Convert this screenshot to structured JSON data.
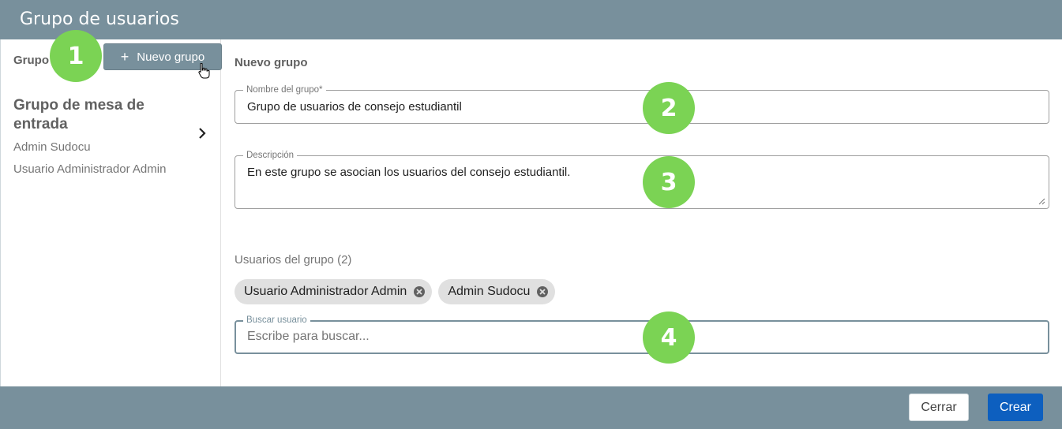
{
  "dialog": {
    "title": "Grupo de usuarios"
  },
  "sidebar": {
    "groups_label": "Grupo",
    "new_group_button": "Nuevo grupo",
    "groups": [
      {
        "name": "Grupo de mesa de entrada",
        "members": [
          "Admin Sudocu",
          "Usuario Administrador Admin"
        ]
      }
    ]
  },
  "form": {
    "section_title": "Nuevo grupo",
    "name_label": "Nombre del grupo*",
    "name_value": "Grupo de usuarios de consejo estudiantil",
    "description_label": "Descripción",
    "description_value": "En este grupo se asocian los usuarios del consejo estudiantil.",
    "users_title": "Usuarios del grupo (2)",
    "selected_users": [
      "Usuario Administrador Admin",
      "Admin Sudocu"
    ],
    "search_label": "Buscar usuario",
    "search_placeholder": "Escribe para buscar..."
  },
  "footer": {
    "close_button": "Cerrar",
    "create_button": "Crear"
  },
  "annotations": [
    "1",
    "2",
    "3",
    "4"
  ],
  "colors": {
    "header": "#78909c",
    "primary": "#0d5fbf",
    "badge": "#7bd354",
    "chip": "#e0e0e0"
  }
}
